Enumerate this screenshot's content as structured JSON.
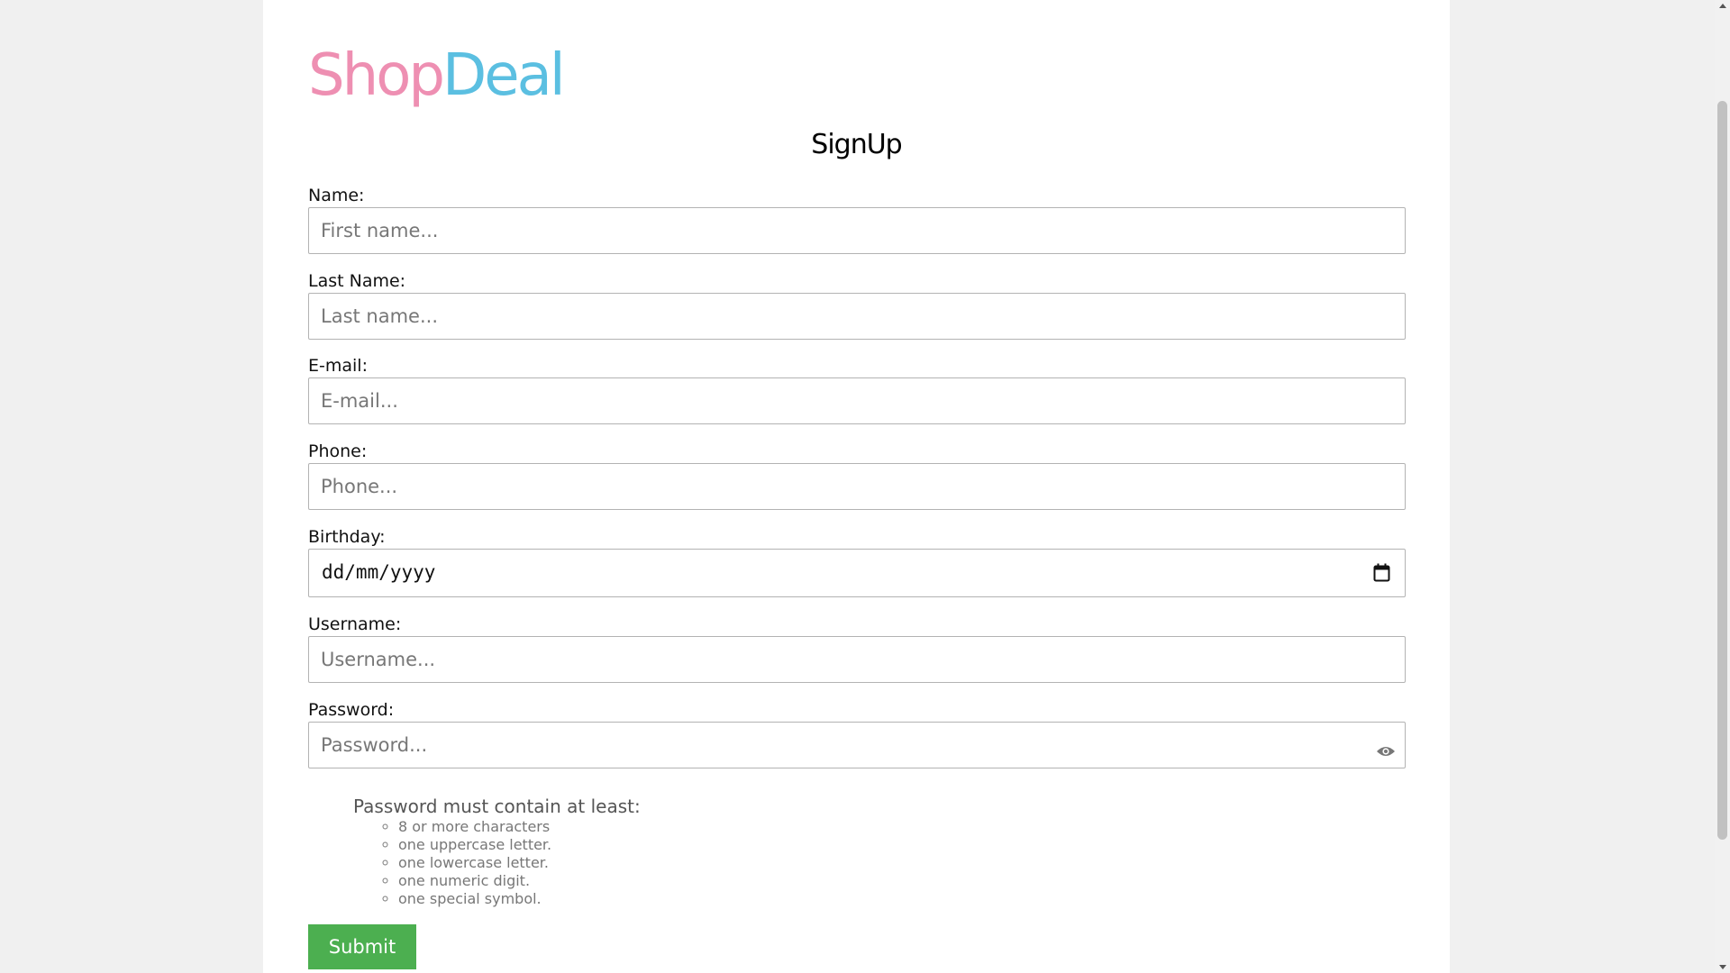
{
  "logo": {
    "part1": "Shop",
    "part2": "Deal"
  },
  "title": "SignUp",
  "fields": {
    "first_name": {
      "label": "Name:",
      "placeholder": "First name..."
    },
    "last_name": {
      "label": "Last Name:",
      "placeholder": "Last name..."
    },
    "email": {
      "label": "E-mail:",
      "placeholder": "E-mail..."
    },
    "phone": {
      "label": "Phone:",
      "placeholder": "Phone..."
    },
    "birthday": {
      "label": "Birthday:",
      "value": "dd/mm/yyyy"
    },
    "username": {
      "label": "Username:",
      "placeholder": "Username..."
    },
    "password": {
      "label": "Password:",
      "placeholder": "Password..."
    }
  },
  "password_rules": {
    "title": "Password must contain at least:",
    "items": [
      "8 or more characters",
      "one uppercase letter.",
      "one lowercase letter.",
      "one numeric digit.",
      "one special symbol."
    ]
  },
  "submit_label": "Submit",
  "colors": {
    "logo_shop": "#ee8fb2",
    "logo_deal": "#5bbfe1",
    "submit": "#4caf50"
  },
  "icons": {
    "date": "calendar-icon",
    "password_toggle": "eye-icon"
  }
}
